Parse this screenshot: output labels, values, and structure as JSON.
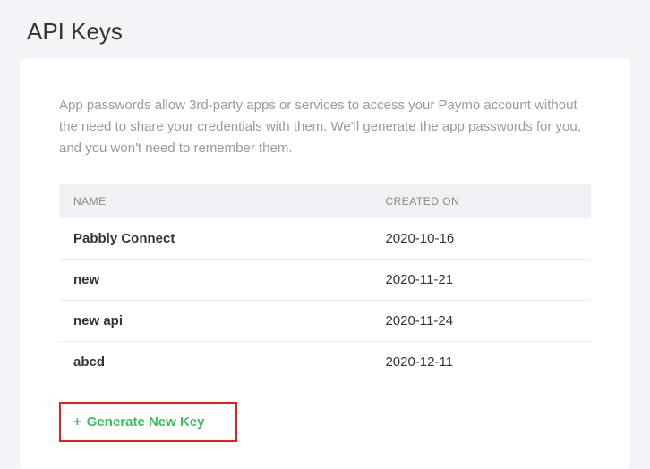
{
  "page": {
    "title": "API Keys"
  },
  "description": "App passwords allow 3rd-party apps or services to access your Paymo account without the need to share your credentials with them. We'll generate the app passwords for you, and you won't need to remember them.",
  "table": {
    "headers": {
      "name": "NAME",
      "created": "CREATED ON"
    },
    "rows": [
      {
        "name": "Pabbly Connect",
        "created": "2020-10-16"
      },
      {
        "name": "new",
        "created": "2020-11-21"
      },
      {
        "name": "new api",
        "created": "2020-11-24"
      },
      {
        "name": "abcd",
        "created": "2020-12-11"
      }
    ]
  },
  "actions": {
    "generate_label": "Generate New Key",
    "plus": "+"
  }
}
